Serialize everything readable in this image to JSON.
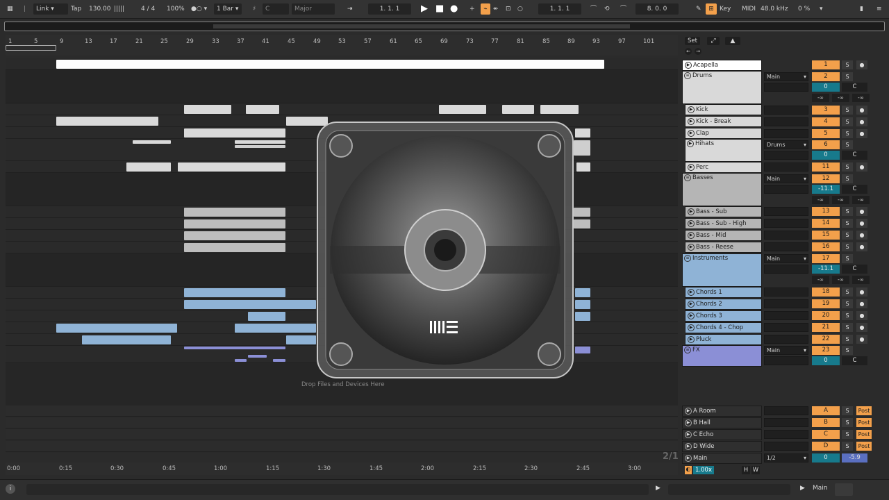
{
  "topbar": {
    "link": "Link",
    "tap": "Tap",
    "tempo": "130.00",
    "signature": "4 / 4",
    "zoom": "100%",
    "quantize": "1 Bar",
    "key": "C",
    "scale": "Major",
    "position": "1.  1.  1",
    "loop_start": "1.  1.  1",
    "loop_length": "8.  0.  0",
    "key_label": "Key",
    "midi_label": "MIDI",
    "sample_rate": "48.0 kHz",
    "cpu": "0 %"
  },
  "ruler": {
    "bars": [
      "1",
      "5",
      "9",
      "13",
      "17",
      "21",
      "25",
      "29",
      "33",
      "37",
      "41",
      "45",
      "49",
      "53",
      "57",
      "61",
      "65",
      "69",
      "73",
      "77",
      "81",
      "85",
      "89",
      "93",
      "97",
      "101"
    ]
  },
  "timeline": {
    "times": [
      "0:00",
      "0:15",
      "0:30",
      "0:45",
      "1:00",
      "1:15",
      "1:30",
      "1:45",
      "2:00",
      "2:15",
      "2:30",
      "2:45",
      "3:00"
    ],
    "fraction": "2/1"
  },
  "drop_text": "Drop Files and Devices Here",
  "mixer": {
    "set_label": "Set",
    "tracks": [
      {
        "name": "Acapella",
        "num": "1",
        "solo": "S"
      },
      {
        "name": "Drums",
        "num": "2",
        "solo": "S",
        "io": "Main",
        "vol": "0",
        "pan": "C",
        "neg": [
          "-∞",
          "-∞",
          "-∞"
        ]
      },
      {
        "name": "Kick",
        "num": "3",
        "solo": "S"
      },
      {
        "name": "Kick - Break",
        "num": "4",
        "solo": "S"
      },
      {
        "name": "Clap",
        "num": "5",
        "solo": "S"
      },
      {
        "name": "Hihats",
        "num": "6",
        "solo": "S",
        "io": "Drums",
        "vol": "0",
        "pan": "C"
      },
      {
        "name": "Perc",
        "num": "11",
        "solo": "S"
      },
      {
        "name": "Basses",
        "num": "12",
        "solo": "S",
        "io": "Main",
        "vol": "-11.1",
        "pan": "C",
        "neg": [
          "-∞",
          "-∞",
          "-∞"
        ]
      },
      {
        "name": "Bass - Sub",
        "num": "13",
        "solo": "S"
      },
      {
        "name": "Bass - Sub - High",
        "num": "14",
        "solo": "S"
      },
      {
        "name": "Bass - Mid",
        "num": "15",
        "solo": "S"
      },
      {
        "name": "Bass - Reese",
        "num": "16",
        "solo": "S"
      },
      {
        "name": "Instruments",
        "num": "17",
        "solo": "S",
        "io": "Main",
        "vol": "-11.1",
        "pan": "C",
        "neg": [
          "-∞",
          "-∞",
          "-∞"
        ]
      },
      {
        "name": "Chords 1",
        "num": "18",
        "solo": "S"
      },
      {
        "name": "Chords 2",
        "num": "19",
        "solo": "S"
      },
      {
        "name": "Chords 3",
        "num": "20",
        "solo": "S"
      },
      {
        "name": "Chords 4 - Chop",
        "num": "21",
        "solo": "S"
      },
      {
        "name": "Pluck",
        "num": "22",
        "solo": "S"
      },
      {
        "name": "FX",
        "num": "23",
        "solo": "S",
        "io": "Main",
        "vol": "0",
        "pan": "C"
      }
    ],
    "returns": [
      {
        "name": "A Room",
        "num": "A",
        "solo": "S",
        "post": "Post"
      },
      {
        "name": "B Hall",
        "num": "B",
        "solo": "S",
        "post": "Post"
      },
      {
        "name": "C Echo",
        "num": "C",
        "solo": "S",
        "post": "Post"
      },
      {
        "name": "D Wide",
        "num": "D",
        "solo": "S",
        "post": "Post"
      }
    ],
    "main": {
      "name": "Main",
      "io": "1/2",
      "vol": "0",
      "pan": "-5.9"
    },
    "speed": "1.00x",
    "h": "H",
    "w": "W"
  },
  "bottombar": {
    "main_label": "Main"
  },
  "colors": {
    "orange": "#f3a04b",
    "teal": "#177a8c",
    "blue": "#8fb3d6",
    "purple": "#8b8fd6",
    "gray": "#b5b5b5"
  }
}
